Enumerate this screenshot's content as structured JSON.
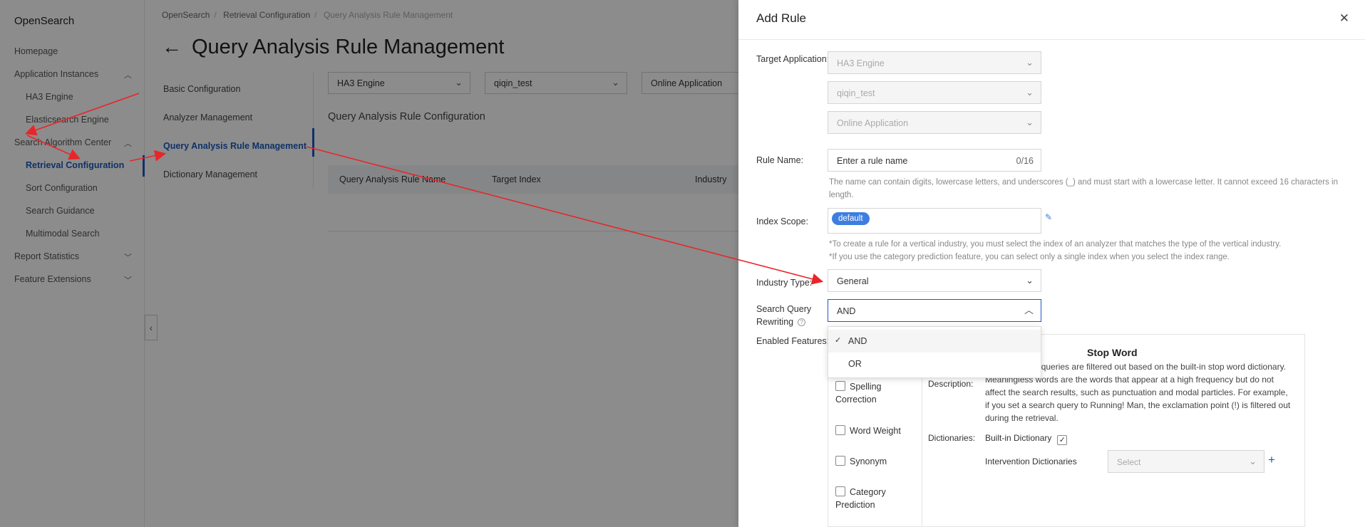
{
  "sidebar": {
    "brand": "OpenSearch",
    "items": [
      {
        "label": "Homepage",
        "level": 0
      },
      {
        "label": "Application Instances",
        "level": 0,
        "chevron": "up"
      },
      {
        "label": "HA3 Engine",
        "level": 1
      },
      {
        "label": "Elasticsearch Engine",
        "level": 1
      },
      {
        "label": "Search Algorithm Center",
        "level": 0,
        "chevron": "up"
      },
      {
        "label": "Retrieval Configuration",
        "level": 1,
        "active": true
      },
      {
        "label": "Sort Configuration",
        "level": 1
      },
      {
        "label": "Search Guidance",
        "level": 1
      },
      {
        "label": "Multimodal Search",
        "level": 1
      },
      {
        "label": "Report Statistics",
        "level": 0,
        "chevron": "down"
      },
      {
        "label": "Feature Extensions",
        "level": 0,
        "chevron": "down"
      }
    ]
  },
  "breadcrumb": [
    "OpenSearch",
    "Retrieval Configuration",
    "Query Analysis Rule Management"
  ],
  "page_title": "Query Analysis Rule Management",
  "subnav": [
    "Basic Configuration",
    "Analyzer Management",
    "Query Analysis Rule Management",
    "Dictionary Management"
  ],
  "filters": {
    "engine": "HA3 Engine",
    "instance": "qiqin_test",
    "app_type": "Online Application"
  },
  "config_title": "Query Analysis Rule Configuration",
  "table_headers": [
    "Query Analysis Rule Name",
    "Target Index",
    "Industry"
  ],
  "drawer": {
    "title": "Add Rule",
    "target_label": "Target Application:",
    "target_values": [
      "HA3 Engine",
      "qiqin_test",
      "Online Application"
    ],
    "rule_name_label": "Rule Name:",
    "rule_name_placeholder": "Enter a rule name",
    "rule_name_counter": "0/16",
    "rule_name_help": "The name can contain digits, lowercase letters, and underscores (_) and must start with a lowercase letter. It cannot exceed 16 characters in length.",
    "index_scope_label": "Index Scope:",
    "index_tag": "default",
    "index_help_1": "*To create a rule for a vertical industry, you must select the index of an analyzer that matches the type of the vertical industry.",
    "index_help_2": "*If you use the category prediction feature, you can select only a single index when you select the index range.",
    "industry_label": "Industry Type:",
    "industry_value": "General",
    "rewrite_label_1": "Search Query",
    "rewrite_label_2": "Rewriting",
    "rewrite_value": "AND",
    "rewrite_options": [
      "AND",
      "OR"
    ],
    "features_label": "Enabled Features:",
    "features": [
      "Spelling Correction",
      "Word Weight",
      "Synonym",
      "Category Prediction"
    ],
    "stopword_title": "Stop Word",
    "description_label": "Description:",
    "description_text": "ords in search queries are filtered out based on the built-in stop word dictionary. Meaningless words are the words that appear at a high frequency but do not affect the search results, such as punctuation and modal particles. For example, if you set a search query to Running! Man, the exclamation point (!) is filtered out during the retrieval.",
    "dictionaries_label": "Dictionaries:",
    "builtin_dict_label": "Built-in Dictionary",
    "intervention_label": "Intervention Dictionaries",
    "intervention_placeholder": "Select"
  }
}
